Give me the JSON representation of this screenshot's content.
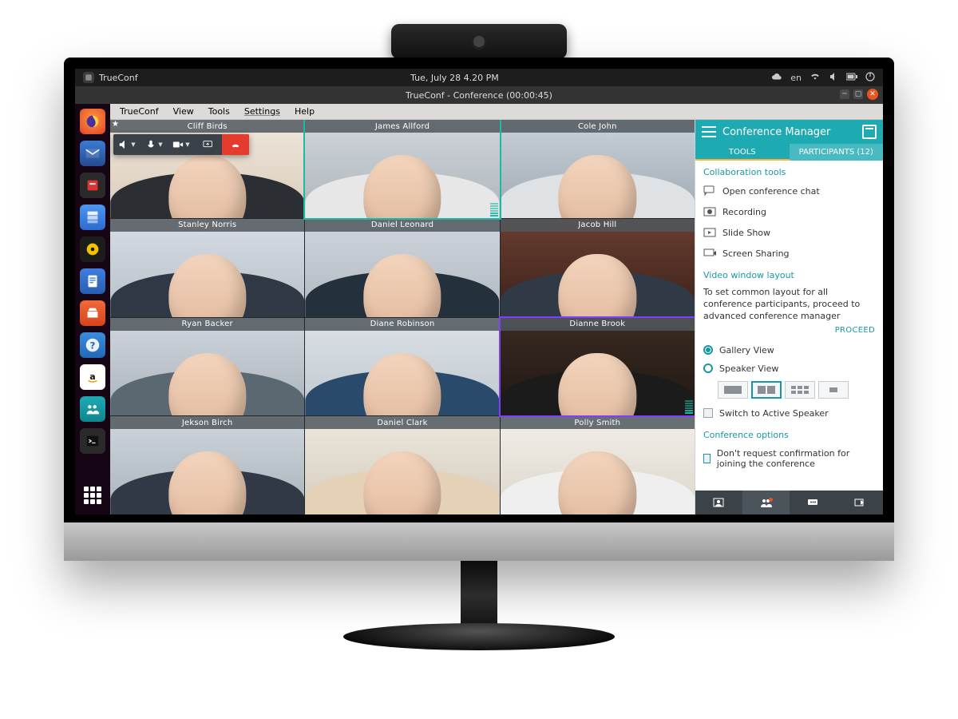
{
  "top_panel": {
    "app_name": "TrueConf",
    "clock": "Tue, July 28 4.20 PM",
    "lang": "en",
    "indicators": [
      "cloud-sync",
      "language",
      "wifi",
      "volume",
      "battery",
      "power"
    ]
  },
  "window": {
    "title": "TrueConf - Conference (00:00:45)"
  },
  "menubar": [
    "TrueConf",
    "View",
    "Tools",
    "Settings",
    "Help"
  ],
  "call_toolbar": {
    "buttons": [
      "volume",
      "mic",
      "camera",
      "share-screen",
      "end-call"
    ]
  },
  "participants": [
    {
      "name": "Cliff Birds",
      "bg": "linear-gradient(#efe6dc,#d9cbb9)",
      "shirt": "#2b2f33",
      "starred": true
    },
    {
      "name": "James Allford",
      "bg": "linear-gradient(#cfd5da,#aeb5bb)",
      "shirt": "#e7e7e7",
      "highlight": "teal",
      "speaking": true
    },
    {
      "name": "Cole John",
      "bg": "linear-gradient(#c8d1d9,#9ea9b2)",
      "shirt": "#dfe2e5"
    },
    {
      "name": "Stanley Norris",
      "bg": "linear-gradient(#d6dde4,#b7bfc7)",
      "shirt": "#2e3945"
    },
    {
      "name": "Daniel Leonard",
      "bg": "linear-gradient(#cfd6dd,#b0b8bf)",
      "shirt": "#24303c"
    },
    {
      "name": "Jacob Hill",
      "bg": "linear-gradient(#6a3d2f,#3a221b)",
      "shirt": "#2f3a46"
    },
    {
      "name": "Ryan Backer",
      "bg": "linear-gradient(#d0d7de,#aab2ba)",
      "shirt": "#5b6771"
    },
    {
      "name": "Diane Robinson",
      "bg": "linear-gradient(#dbe1e6,#bfc7ce)",
      "shirt": "#2a4a6b"
    },
    {
      "name": "Dianne Brook",
      "bg": "linear-gradient(#3b2b22,#1f1712)",
      "shirt": "#1b1b1b",
      "highlight": "purple",
      "speaking": true
    },
    {
      "name": "Jekson Birch",
      "bg": "linear-gradient(#cfd6dd,#a9b2ba)",
      "shirt": "#303945"
    },
    {
      "name": "Daniel Clark",
      "bg": "linear-gradient(#ece7de,#d5ccbd)",
      "shirt": "#e5d1b5"
    },
    {
      "name": "Polly Smith",
      "bg": "linear-gradient(#f2efe9,#dcd6ca)",
      "shirt": "#efefef"
    }
  ],
  "conference_manager": {
    "title": "Conference Manager",
    "tabs": {
      "tools": "TOOLS",
      "participants": "PARTICIPANTS (12)"
    },
    "collab_title": "Collaboration tools",
    "collab_items": [
      {
        "icon": "chat",
        "label": "Open conference chat"
      },
      {
        "icon": "record",
        "label": "Recording"
      },
      {
        "icon": "slides",
        "label": "Slide Show"
      },
      {
        "icon": "screen",
        "label": "Screen Sharing"
      }
    ],
    "layout_title": "Video window layout",
    "layout_hint": "To set common layout for all conference participants, proceed to advanced conference manager",
    "proceed": "PROCEED",
    "views": {
      "gallery": "Gallery View",
      "speaker": "Speaker View"
    },
    "switch_label": "Switch to Active Speaker",
    "options_title": "Conference options",
    "option_noconfirm": "Don't request confirmation for joining the conference"
  },
  "dock": {
    "items": [
      "firefox",
      "thunderbird",
      "transmission",
      "files",
      "rhythmbox",
      "writer",
      "software",
      "help",
      "amazon",
      "trueconf",
      "terminal"
    ]
  }
}
